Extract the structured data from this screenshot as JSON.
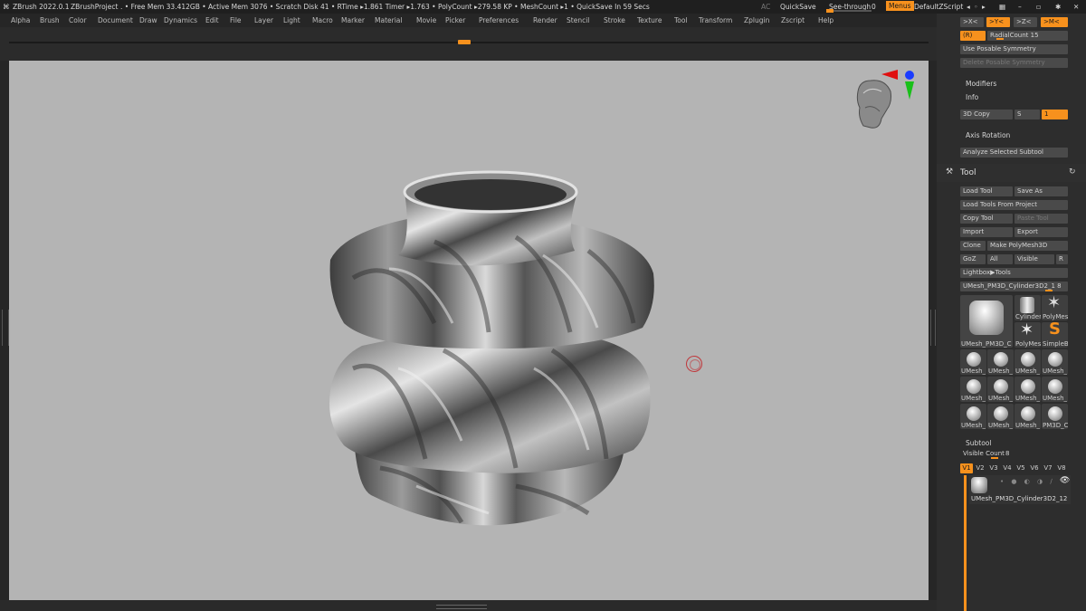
{
  "titlebar": {
    "app": "ZBrush 2022.0.1",
    "project": "ZBrushProject",
    "stats": ". • Free Mem 33.412GB • Active Mem 3076 • Scratch Disk 41 •  RTime ▸1.861 Timer ▸1.763 • PolyCount ▸279.58 KP  • MeshCount ▸1  • QuickSave In 59 Secs",
    "ac": "AC",
    "quicksave": "QuickSave",
    "seethrough_label": "See-through",
    "seethrough_value": "0",
    "menus": "Menus",
    "script": "DefaultZScript"
  },
  "menu": [
    "Alpha",
    "Brush",
    "Color",
    "Document",
    "Draw",
    "Dynamics",
    "Edit",
    "File",
    "Layer",
    "Light",
    "Macro",
    "Marker",
    "Material",
    "Movie",
    "Picker",
    "Preferences",
    "Render",
    "Stencil",
    "Stroke",
    "Texture",
    "Tool",
    "Transform",
    "Zplugin",
    "Zscript",
    "Help"
  ],
  "symmetry": {
    "x": ">X<",
    "y": ">Y<",
    "z": ">Z<",
    "m": ">M<",
    "r": "(R)",
    "radial_label": "RadialCount",
    "radial_value": "15",
    "posable": "Use Posable Symmetry",
    "delete_posable": "Delete Posable Symmetry"
  },
  "sections": {
    "modifiers": "Modifiers",
    "info": "Info",
    "copy3d": "3D Copy",
    "s": "S",
    "one": "1",
    "axis_rotation": "Axis Rotation",
    "analyze": "Analyze Selected Subtool"
  },
  "tool": {
    "title": "Tool",
    "load_tool": "Load Tool",
    "save_as": "Save As",
    "load_from_project": "Load Tools From Project",
    "copy_tool": "Copy Tool",
    "paste_tool": "Paste Tool",
    "import": "Import",
    "export": "Export",
    "clone": "Clone",
    "make_polymesh": "Make PolyMesh3D",
    "goz": "GoZ",
    "all": "All",
    "visible": "Visible",
    "r": "R",
    "lightbox": "Lightbox▶Tools",
    "current_tool": "UMesh_PM3D_Cylinder3D2_1",
    "current_count": "8",
    "thumbs": [
      {
        "cap": "UMesh_PM3D_C"
      },
      {
        "cap": "Cylinder"
      },
      {
        "cap": "PolyMes"
      },
      {
        "cap": "PolyMes"
      },
      {
        "cap": "SimpleB"
      },
      {
        "cap": "UMesh_"
      },
      {
        "cap": "UMesh_"
      },
      {
        "cap": "UMesh_"
      },
      {
        "cap": "UMesh_"
      },
      {
        "cap": "UMesh_"
      },
      {
        "cap": "UMesh_"
      },
      {
        "cap": "UMesh_"
      },
      {
        "cap": "UMesh_"
      },
      {
        "cap": "UMesh_"
      },
      {
        "cap": "UMesh_"
      },
      {
        "cap": "UMesh_"
      },
      {
        "cap": "PM3D_C"
      }
    ]
  },
  "subtool": {
    "title": "Subtool",
    "visible_count_label": "Visible Count",
    "visible_count_value": "8",
    "versions": [
      "V1",
      "V2",
      "V3",
      "V4",
      "V5",
      "V6",
      "V7",
      "V8"
    ],
    "item_name": "UMesh_PM3D_Cylinder3D2_12"
  },
  "colors": {
    "accent": "#f7911d",
    "viewport_bg": "#b4b4b4",
    "panel_bg": "#2d2d2d"
  }
}
